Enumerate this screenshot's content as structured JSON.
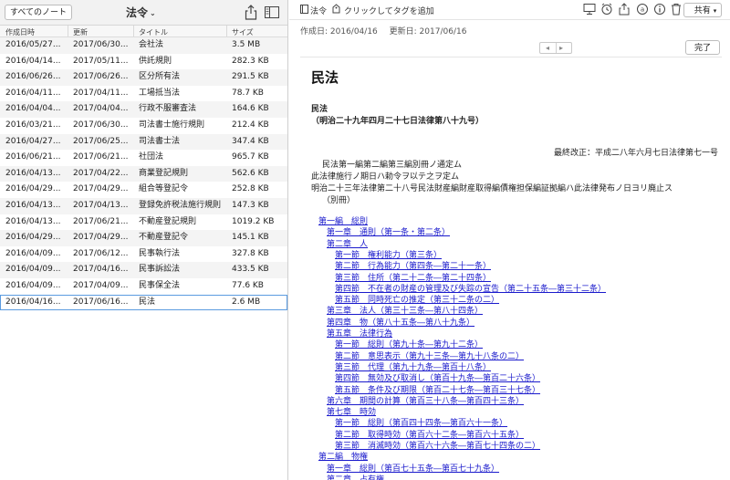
{
  "left": {
    "all_notes_label": "すべてのノート",
    "notebook_title": "法令",
    "columns": [
      "作成日時",
      "更新",
      "タイトル",
      "サイズ"
    ],
    "rows": [
      [
        "2016/05/27...",
        "2017/06/30...",
        "会社法",
        "3.5 MB"
      ],
      [
        "2016/04/14...",
        "2017/05/11...",
        "供託規則",
        "282.3 KB"
      ],
      [
        "2016/06/26...",
        "2017/06/26...",
        "区分所有法",
        "291.5 KB"
      ],
      [
        "2016/04/11...",
        "2017/04/11...",
        "工場抵当法",
        "78.7 KB"
      ],
      [
        "2016/04/04...",
        "2017/04/04...",
        "行政不服審査法",
        "164.6 KB"
      ],
      [
        "2016/03/21...",
        "2017/06/30...",
        "司法書士施行規則",
        "212.4 KB"
      ],
      [
        "2016/04/27...",
        "2017/06/25...",
        "司法書士法",
        "347.4 KB"
      ],
      [
        "2016/06/21...",
        "2017/06/21...",
        "社団法",
        "965.7 KB"
      ],
      [
        "2016/04/13...",
        "2017/04/22...",
        "商業登記規則",
        "562.6 KB"
      ],
      [
        "2016/04/29...",
        "2017/04/29...",
        "組合等登記令",
        "252.8 KB"
      ],
      [
        "2016/04/13...",
        "2017/04/13...",
        "登録免許税法施行規則",
        "147.3 KB"
      ],
      [
        "2016/04/13...",
        "2017/06/21...",
        "不動産登記規則",
        "1019.2 KB"
      ],
      [
        "2016/04/29...",
        "2017/04/29...",
        "不動産登記令",
        "145.1 KB"
      ],
      [
        "2016/04/09...",
        "2017/06/12...",
        "民事執行法",
        "327.8 KB"
      ],
      [
        "2016/04/09...",
        "2017/04/16...",
        "民事訴訟法",
        "433.5 KB"
      ],
      [
        "2016/04/09...",
        "2017/04/09...",
        "民事保全法",
        "77.6 KB"
      ],
      [
        "2016/04/16...",
        "2017/06/16...",
        "民法",
        "2.6 MB"
      ]
    ],
    "selected_index": 16
  },
  "right": {
    "notebook_label": "法令",
    "tag_placeholder": "クリックしてタグを追加",
    "share_label": "共有",
    "created": "作成日: 2016/04/16",
    "updated": "更新日: 2017/06/16",
    "done_label": "完了",
    "nav_prev": "◂",
    "nav_next": "▸",
    "doc": {
      "title": "民法",
      "law_name": "民法",
      "law_number": "（明治二十九年四月二十七日法律第八十九号）",
      "last_amend": "最終改正：平成二八年六月七日法律第七一号",
      "pre_lines": [
        "民法第一編第二編第三編別冊ノ通定ム",
        "此法律施行ノ期日ハ勅令ヲ以テ之ヲ定ム",
        "明治二十三年法律第二十八号民法財産編財産取得編債権担保編証拠編ハ此法律発布ノ日ヨリ廃止ス",
        "（別冊）"
      ],
      "toc": [
        {
          "level": 0,
          "text": "第一編　総則"
        },
        {
          "level": 1,
          "text": "第一章　通則（第一条・第二条）"
        },
        {
          "level": 1,
          "text": "第二章　人"
        },
        {
          "level": 2,
          "text": "第一節　権利能力（第三条）"
        },
        {
          "level": 2,
          "text": "第二節　行為能力（第四条―第二十一条）"
        },
        {
          "level": 2,
          "text": "第三節　住所（第二十二条―第二十四条）"
        },
        {
          "level": 2,
          "text": "第四節　不在者の財産の管理及び失踪の宣告（第二十五条―第三十二条）"
        },
        {
          "level": 2,
          "text": "第五節　同時死亡の推定（第三十二条の二）"
        },
        {
          "level": 1,
          "text": "第三章　法人（第三十三条―第八十四条）"
        },
        {
          "level": 1,
          "text": "第四章　物（第八十五条―第八十九条）"
        },
        {
          "level": 1,
          "text": "第五章　法律行為"
        },
        {
          "level": 2,
          "text": "第一節　総則（第九十条―第九十二条）"
        },
        {
          "level": 2,
          "text": "第二節　意思表示（第九十三条―第九十八条の二）"
        },
        {
          "level": 2,
          "text": "第三節　代理（第九十九条―第百十八条）"
        },
        {
          "level": 2,
          "text": "第四節　無効及び取消し（第百十九条―第百二十六条）"
        },
        {
          "level": 2,
          "text": "第五節　条件及び期限（第百二十七条―第百三十七条）"
        },
        {
          "level": 1,
          "text": "第六章　期間の計算（第百三十八条―第百四十三条）"
        },
        {
          "level": 1,
          "text": "第七章　時効"
        },
        {
          "level": 2,
          "text": "第一節　総則（第百四十四条―第百六十一条）"
        },
        {
          "level": 2,
          "text": "第二節　取得時効（第百六十二条―第百六十五条）"
        },
        {
          "level": 2,
          "text": "第三節　消滅時効（第百六十六条―第百七十四条の二）"
        },
        {
          "level": 0,
          "text": "第二編　物権"
        },
        {
          "level": 1,
          "text": "第一章　総則（第百七十五条―第百七十九条）"
        },
        {
          "level": 1,
          "text": "第二章　占有権"
        }
      ]
    }
  },
  "colors": {
    "link": "#1a1acc",
    "selection_border": "#5b9be0"
  }
}
